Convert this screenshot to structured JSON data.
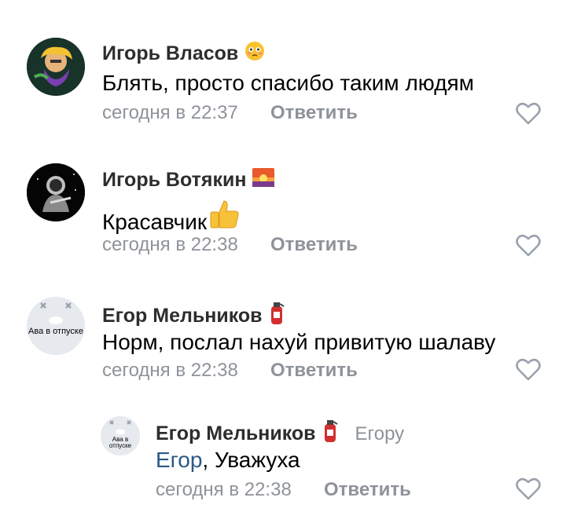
{
  "comments": [
    {
      "author": "Игорь Власов",
      "author_emoji": "flushed-face-icon",
      "text": "Блять, просто спасибо таким людям",
      "time": "сегодня в 22:37",
      "reply_label": "Ответить"
    },
    {
      "author": "Игорь Вотякин",
      "author_emoji": "sunset-icon",
      "text": "Красавчик",
      "text_emoji": "thumbs-up-icon",
      "time": "сегодня в 22:38",
      "reply_label": "Ответить"
    },
    {
      "author": "Егор Мельников",
      "author_emoji": "fire-extinguisher-icon",
      "avatar_text": "Ава в отпуске",
      "text": "Норм, послал нахуй привитую шалаву",
      "time": "сегодня в 22:38",
      "reply_label": "Ответить"
    }
  ],
  "reply_comment": {
    "author": "Егор Мельников",
    "author_emoji": "fire-extinguisher-icon",
    "avatar_text": "Ава в отпуске",
    "to": "Егору",
    "mention": "Егор",
    "text": ", Уважуха",
    "time": "сегодня в 22:38",
    "reply_label": "Ответить"
  },
  "colors": {
    "meta": "#8e9399",
    "link": "#2a5885",
    "text": "#000000"
  }
}
